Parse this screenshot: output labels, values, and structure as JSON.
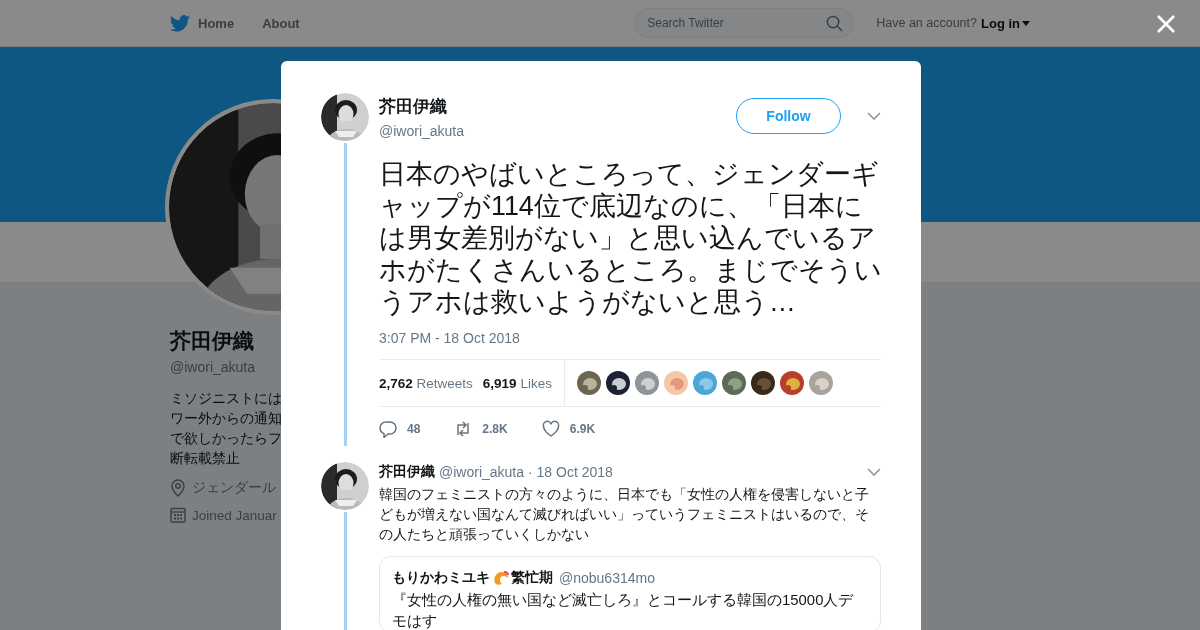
{
  "top_nav": {
    "links": [
      {
        "label": "Home",
        "kind": "home"
      },
      {
        "label": "About",
        "kind": "plain"
      }
    ],
    "search": {
      "placeholder": "Search Twitter"
    },
    "account_prompt": "Have an account?",
    "login": "Log in"
  },
  "profile": {
    "name": "芥田伊織",
    "handle": "@iwori_akuta",
    "bio_lines": [
      "ミソジニストには",
      "ワー外からの通知",
      "で欲しかったらフ",
      "断転載禁止"
    ],
    "location": "ジェンダール",
    "joined": "Joined Januar"
  },
  "tweet": {
    "name": "芥田伊織",
    "handle": "@iwori_akuta",
    "follow": "Follow",
    "text": "日本のやばいところって、ジェンダーギャップが114位で底辺なのに、「日本には男女差別がない」と思い込んでいるアホがたくさんいるところ。まじでそういうアホは救いようがないと思う…",
    "time": "3:07 PM - 18 Oct 2018",
    "stats": [
      {
        "count": "2,762",
        "label": "Retweets"
      },
      {
        "count": "6,919",
        "label": "Likes"
      }
    ],
    "actions": [
      {
        "kind": "reply",
        "count": "48"
      },
      {
        "kind": "retweet",
        "count": "2.8K"
      },
      {
        "kind": "like",
        "count": "6.9K"
      }
    ]
  },
  "reply": {
    "name": "芥田伊織",
    "handle": "@iwori_akuta",
    "date": "· 18 Oct 2018",
    "text": "韓国のフェミニストの方々のように、日本でも「女性の人権を侵害しないと子どもが増えない国なんて滅びればいい」っていうフェミニストはいるので、その人たちと頑張っていくしかない",
    "quote": {
      "name": "もりかわミユキ",
      "name_suffix": "繁忙期",
      "handle": "@nobu6314mo",
      "text": "『女性の人権の無い国など滅亡しろ』とコールする韓国の15000人デモはす"
    }
  }
}
